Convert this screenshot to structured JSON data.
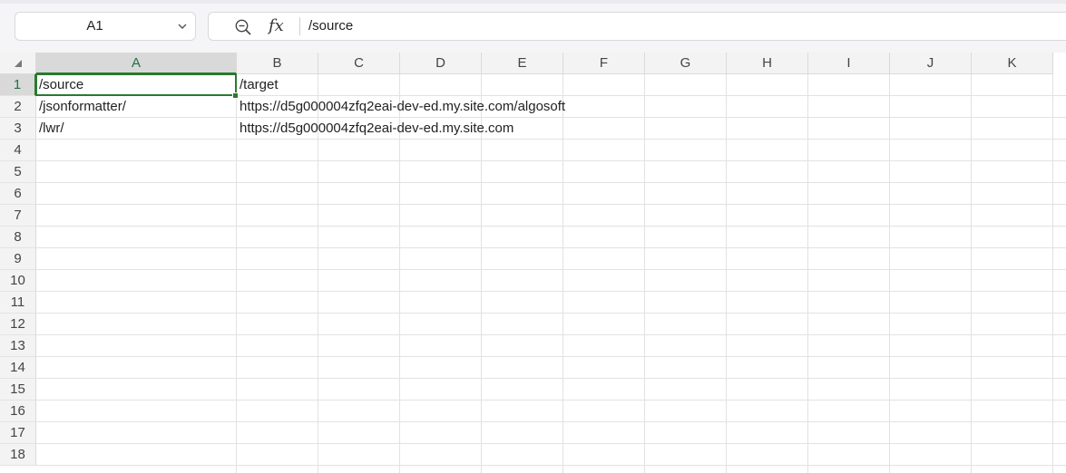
{
  "name_box": {
    "value": "A1"
  },
  "formula_bar": {
    "value": "/source",
    "fx_label": "fx"
  },
  "icons": {
    "name_box_dropdown": "chevron-down-icon",
    "zoom": "zoom-out-icon",
    "function": "fx-icon",
    "select_all": "select-all-triangle-icon"
  },
  "colors": {
    "selection": "#2a7a2e",
    "selected_header_text": "#1e7145"
  },
  "selected_cell": "A1",
  "columns": [
    "A",
    "B",
    "C",
    "D",
    "E",
    "F",
    "G",
    "H",
    "I",
    "J",
    "K"
  ],
  "rows": [
    "1",
    "2",
    "3",
    "4",
    "5",
    "6",
    "7",
    "8",
    "9",
    "10",
    "11",
    "12",
    "13",
    "14",
    "15",
    "16",
    "17",
    "18"
  ],
  "cells": {
    "A1": "/source",
    "B1": "/target",
    "A2": "/jsonformatter/",
    "B2": "https://d5g000004zfq2eai-dev-ed.my.site.com/algosoft",
    "A3": "/lwr/",
    "B3": "https://d5g000004zfq2eai-dev-ed.my.site.com"
  }
}
